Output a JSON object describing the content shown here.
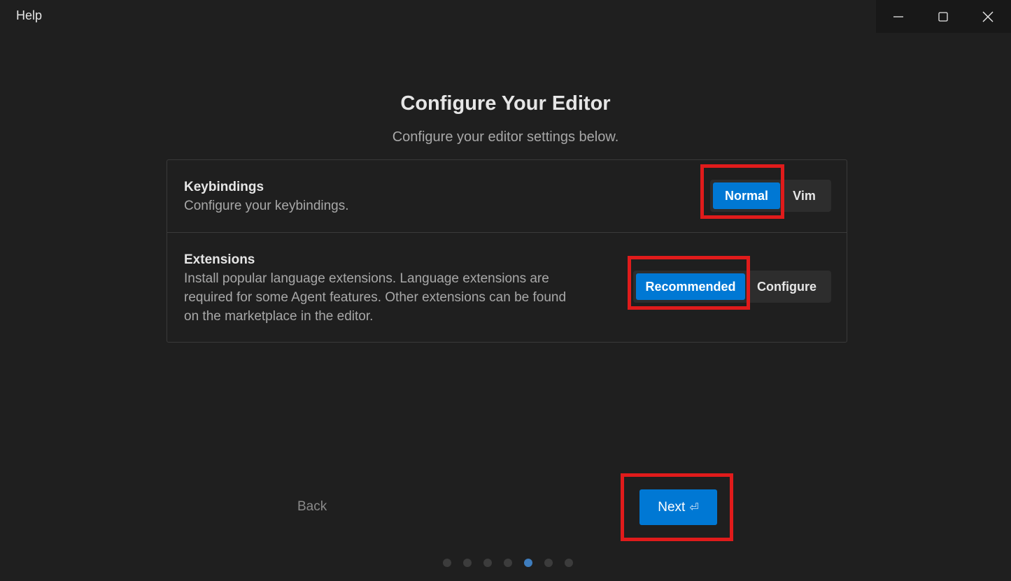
{
  "titlebar": {
    "menu_label": "Help",
    "controls": {
      "minimize_icon": "minimize-icon",
      "maximize_icon": "maximize-icon",
      "close_icon": "close-icon"
    }
  },
  "header": {
    "title": "Configure Your Editor",
    "subtitle": "Configure your editor settings below."
  },
  "settings": {
    "keybindings": {
      "title": "Keybindings",
      "description": "Configure your keybindings.",
      "options": [
        "Normal",
        "Vim"
      ],
      "selected": "Normal"
    },
    "extensions": {
      "title": "Extensions",
      "description": "Install popular language extensions. Language extensions are required for some Agent features. Other extensions can be found on the marketplace in the editor.",
      "options": [
        "Recommended",
        "Configure"
      ],
      "selected": "Recommended"
    }
  },
  "footer": {
    "back_label": "Back",
    "next_label": "Next",
    "next_icon": "enter-key-icon"
  },
  "progress": {
    "total_steps": 7,
    "current_step": 5
  },
  "colors": {
    "background": "#1f1f1f",
    "accent": "#0078d4",
    "annotation": "#e01b1b",
    "active_dot": "#3e7dbe"
  }
}
